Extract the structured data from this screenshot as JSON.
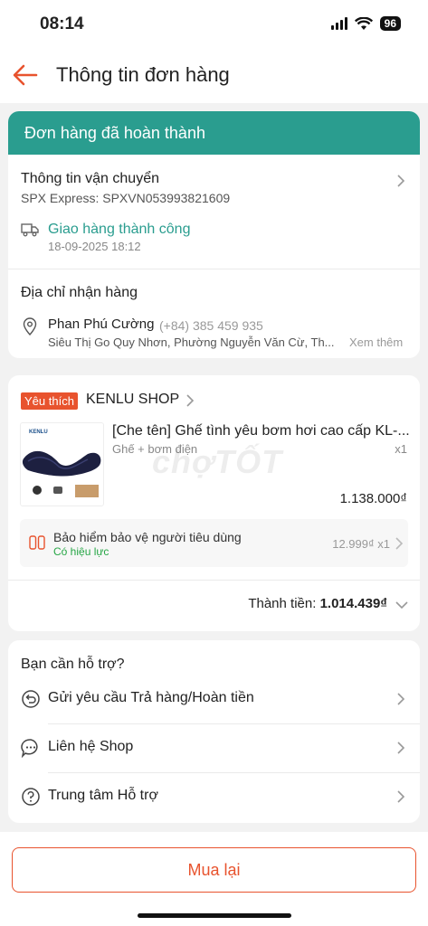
{
  "status_bar": {
    "time": "08:14",
    "battery": "96"
  },
  "header": {
    "title": "Thông tin đơn hàng"
  },
  "order_status": "Đơn hàng đã hoàn thành",
  "shipping": {
    "title": "Thông tin vận chuyển",
    "carrier_code": "SPX Express: SPXVN053993821609",
    "status": "Giao hàng thành công",
    "datetime": "18-09-2025 18:12"
  },
  "address": {
    "title": "Địa chỉ nhận hàng",
    "name": "Phan Phú Cường",
    "phone": "(+84) 385 459 935",
    "detail": "Siêu Thị Go Quy Nhơn, Phường Nguyễn Văn Cừ, Th...",
    "more": "Xem thêm"
  },
  "shop": {
    "badge": "Yêu thích",
    "name": "KENLU SHOP",
    "product_name": "[Che tên] Ghế tình yêu bơm hơi cao cấp KL-...",
    "variant": "Ghế + bơm điện",
    "quantity": "x1",
    "price": "1.138.000₫",
    "thumb_brand": "KENLU"
  },
  "insurance": {
    "name": "Bảo hiểm bảo vệ người tiêu dùng",
    "status": "Có hiệu lực",
    "price": "12.999₫ x1"
  },
  "total": {
    "label": "Thành tiền:",
    "value": "1.014.439₫"
  },
  "support": {
    "title": "Bạn cần hỗ trợ?",
    "items": [
      {
        "label": "Gửi yêu cầu Trả hàng/Hoàn tiền",
        "icon": "return-icon"
      },
      {
        "label": "Liên hệ Shop",
        "icon": "chat-icon"
      },
      {
        "label": "Trung tâm Hỗ trợ",
        "icon": "help-icon"
      }
    ]
  },
  "actions": {
    "buy_again": "Mua lại"
  },
  "watermark": "chợTỐT",
  "colors": {
    "accent": "#e8532e",
    "banner": "#2a9d8f",
    "success": "#26a645"
  }
}
